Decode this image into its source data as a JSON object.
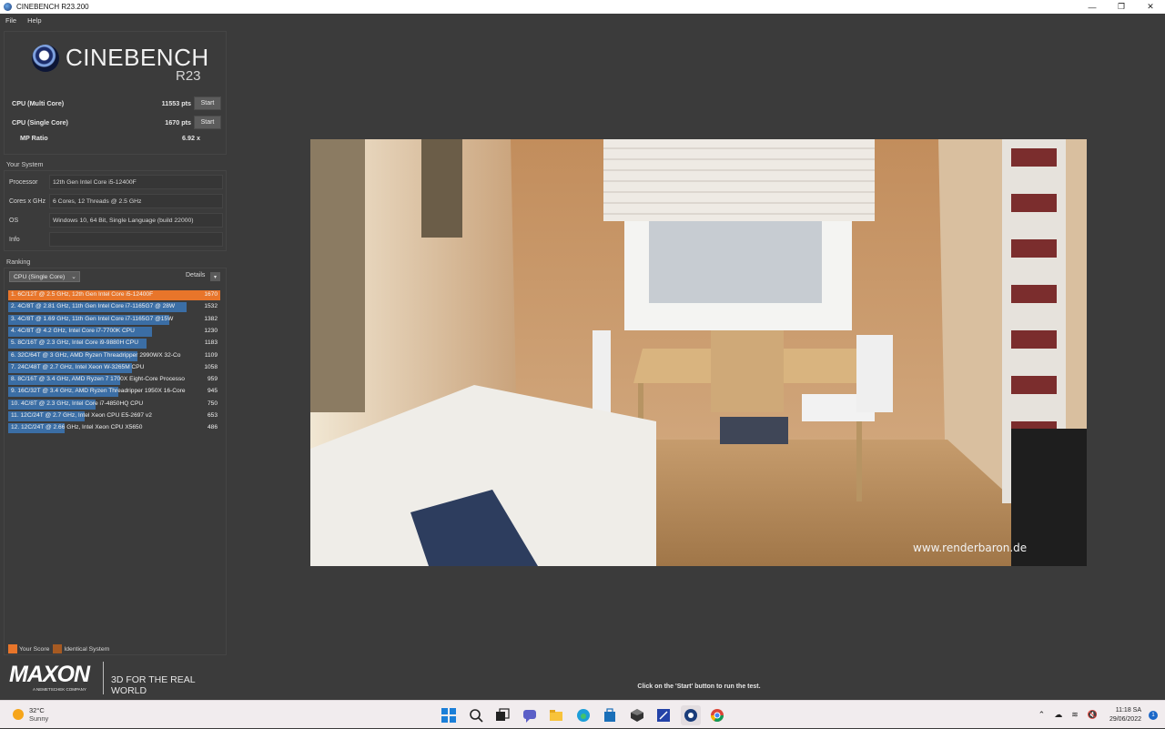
{
  "window": {
    "title": "CINEBENCH R23.200",
    "controls": [
      "—",
      "❐",
      "✕"
    ]
  },
  "menu": [
    "File",
    "Help"
  ],
  "logo": {
    "name": "CINEBENCH",
    "version": "R23"
  },
  "scores": {
    "multi": {
      "label": "CPU (Multi Core)",
      "value": "11553 pts",
      "button": "Start"
    },
    "single": {
      "label": "CPU (Single Core)",
      "value": "1670 pts",
      "button": "Start"
    },
    "mp": {
      "label": "MP Ratio",
      "value": "6.92 x"
    }
  },
  "system": {
    "title": "Your System",
    "rows": [
      {
        "label": "Processor",
        "value": "12th Gen Intel Core i5-12400F"
      },
      {
        "label": "Cores x GHz",
        "value": "6 Cores, 12 Threads @ 2.5 GHz"
      },
      {
        "label": "OS",
        "value": "Windows 10, 64 Bit, Single Language (build 22000)"
      },
      {
        "label": "Info",
        "value": ""
      }
    ]
  },
  "ranking": {
    "title": "Ranking",
    "selected": "CPU (Single Core)",
    "details_label": "Details",
    "max_score": 1670,
    "rows": [
      {
        "text": "1. 6C/12T @ 2.5 GHz, 12th Gen Intel Core i5-12400F",
        "score": 1670,
        "mine": true
      },
      {
        "text": "2. 4C/8T @ 2.81 GHz, 11th Gen Intel Core i7-1165G7 @ 28W",
        "score": 1532,
        "mine": false
      },
      {
        "text": "3. 4C/8T @ 1.69 GHz, 11th Gen Intel Core i7-1165G7 @15W",
        "score": 1382,
        "mine": false
      },
      {
        "text": "4. 4C/8T @ 4.2 GHz, Intel Core i7-7700K CPU",
        "score": 1230,
        "mine": false
      },
      {
        "text": "5. 8C/16T @ 2.3 GHz, Intel Core i9-9880H CPU",
        "score": 1183,
        "mine": false
      },
      {
        "text": "6. 32C/64T @ 3 GHz, AMD Ryzen Threadripper 2990WX 32-Co",
        "score": 1109,
        "mine": false
      },
      {
        "text": "7. 24C/48T @ 2.7 GHz, Intel Xeon W-3265M CPU",
        "score": 1058,
        "mine": false
      },
      {
        "text": "8. 8C/16T @ 3.4 GHz, AMD Ryzen 7 1700X Eight-Core Processo",
        "score": 959,
        "mine": false
      },
      {
        "text": "9. 16C/32T @ 3.4 GHz, AMD Ryzen Threadripper 1950X 16-Core",
        "score": 945,
        "mine": false
      },
      {
        "text": "10. 4C/8T @ 2.3 GHz, Intel Core i7-4850HQ CPU",
        "score": 750,
        "mine": false
      },
      {
        "text": "11. 12C/24T @ 2.7 GHz, Intel Xeon CPU E5-2697 v2",
        "score": 653,
        "mine": false
      },
      {
        "text": "12. 12C/24T @ 2.66 GHz, Intel Xeon CPU X5650",
        "score": 486,
        "mine": false
      }
    ]
  },
  "legend": {
    "your_score": "Your Score",
    "identical": "Identical System"
  },
  "brand": {
    "name": "MAXON",
    "sub": "A NEMETSCHEK COMPANY",
    "tagline": "3D FOR THE REAL WORLD"
  },
  "render": {
    "watermark": "www.renderbaron.de"
  },
  "hint": "Click on the 'Start' button to run the test.",
  "taskbar": {
    "weather_temp": "32°C",
    "weather_cond": "Sunny",
    "time": "11:18 SA",
    "date": "29/06/2022",
    "notif_count": "1"
  },
  "colors": {
    "accent": "#e8752a",
    "bar": "#3b6ea5",
    "identical": "#a65a22"
  }
}
